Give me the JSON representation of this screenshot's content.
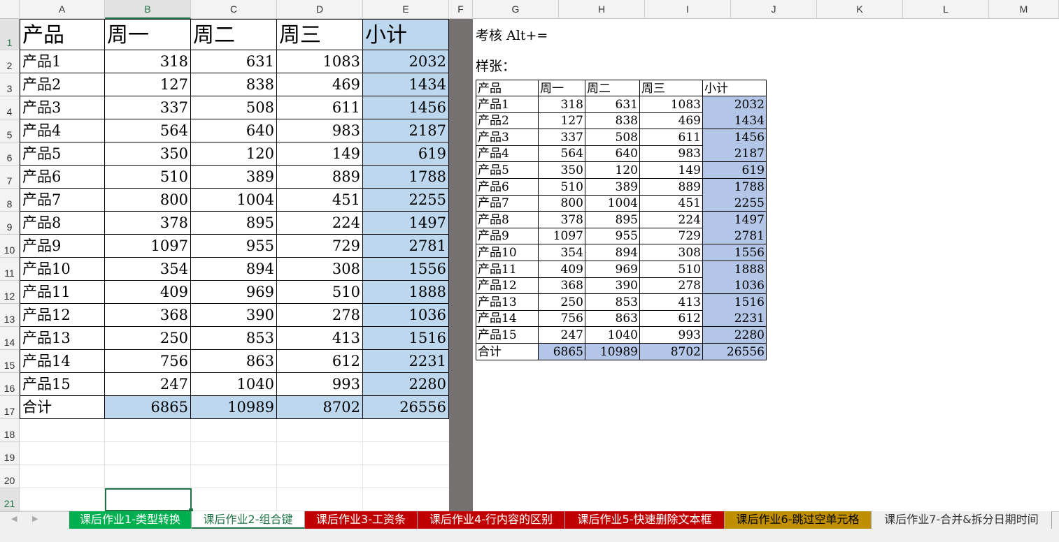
{
  "columns": [
    "A",
    "B",
    "C",
    "D",
    "E",
    "F",
    "G",
    "H",
    "I",
    "J",
    "K",
    "L",
    "M"
  ],
  "rows": [
    "1",
    "2",
    "3",
    "4",
    "5",
    "6",
    "7",
    "8",
    "9",
    "10",
    "11",
    "12",
    "13",
    "14",
    "15",
    "16",
    "17",
    "18",
    "19",
    "20",
    "21"
  ],
  "table": {
    "headers": [
      "产品",
      "周一",
      "周二",
      "周三",
      "小计"
    ],
    "rows": [
      [
        "产品1",
        "318",
        "631",
        "1083",
        "2032"
      ],
      [
        "产品2",
        "127",
        "838",
        "469",
        "1434"
      ],
      [
        "产品3",
        "337",
        "508",
        "611",
        "1456"
      ],
      [
        "产品4",
        "564",
        "640",
        "983",
        "2187"
      ],
      [
        "产品5",
        "350",
        "120",
        "149",
        "619"
      ],
      [
        "产品6",
        "510",
        "389",
        "889",
        "1788"
      ],
      [
        "产品7",
        "800",
        "1004",
        "451",
        "2255"
      ],
      [
        "产品8",
        "378",
        "895",
        "224",
        "1497"
      ],
      [
        "产品9",
        "1097",
        "955",
        "729",
        "2781"
      ],
      [
        "产品10",
        "354",
        "894",
        "308",
        "1556"
      ],
      [
        "产品11",
        "409",
        "969",
        "510",
        "1888"
      ],
      [
        "产品12",
        "368",
        "390",
        "278",
        "1036"
      ],
      [
        "产品13",
        "250",
        "853",
        "413",
        "1516"
      ],
      [
        "产品14",
        "756",
        "863",
        "612",
        "2231"
      ],
      [
        "产品15",
        "247",
        "1040",
        "993",
        "2280"
      ]
    ],
    "total": [
      "合计",
      "6865",
      "10989",
      "8702",
      "26556"
    ]
  },
  "note": {
    "line1": "考核 Alt+=",
    "line2": "样张："
  },
  "sample": {
    "headers": [
      "产品",
      "周一",
      "周二",
      "周三",
      "小计"
    ],
    "rows": [
      [
        "产品1",
        "318",
        "631",
        "1083",
        "2032"
      ],
      [
        "产品2",
        "127",
        "838",
        "469",
        "1434"
      ],
      [
        "产品3",
        "337",
        "508",
        "611",
        "1456"
      ],
      [
        "产品4",
        "564",
        "640",
        "983",
        "2187"
      ],
      [
        "产品5",
        "350",
        "120",
        "149",
        "619"
      ],
      [
        "产品6",
        "510",
        "389",
        "889",
        "1788"
      ],
      [
        "产品7",
        "800",
        "1004",
        "451",
        "2255"
      ],
      [
        "产品8",
        "378",
        "895",
        "224",
        "1497"
      ],
      [
        "产品9",
        "1097",
        "955",
        "729",
        "2781"
      ],
      [
        "产品10",
        "354",
        "894",
        "308",
        "1556"
      ],
      [
        "产品11",
        "409",
        "969",
        "510",
        "1888"
      ],
      [
        "产品12",
        "368",
        "390",
        "278",
        "1036"
      ],
      [
        "产品13",
        "250",
        "853",
        "413",
        "1516"
      ],
      [
        "产品14",
        "756",
        "863",
        "612",
        "2231"
      ],
      [
        "产品15",
        "247",
        "1040",
        "993",
        "2280"
      ]
    ],
    "total": [
      "合计",
      "6865",
      "10989",
      "8702",
      "26556"
    ]
  },
  "tabs": [
    {
      "label": "课后作业1-类型转换",
      "bg": "#00b050",
      "color": "#ffffff"
    },
    {
      "label": "课后作业2-组合键",
      "bg": "#ffffff",
      "color": "#217346",
      "active": true
    },
    {
      "label": "课后作业3-工资条",
      "bg": "#c00000",
      "color": "#ffffff"
    },
    {
      "label": "课后作业4-行内容的区别",
      "bg": "#c00000",
      "color": "#ffffff"
    },
    {
      "label": "课后作业5-快速删除文本框",
      "bg": "#c00000",
      "color": "#ffffff"
    },
    {
      "label": "课后作业6-跳过空单元格",
      "bg": "#bf8f00",
      "color": "#000000"
    },
    {
      "label": "课后作业7-合并&拆分日期时间",
      "bg": "#f0f0f0",
      "color": "#333333"
    }
  ],
  "nav": {
    "prev": "◀",
    "next": "▶"
  },
  "colors": {
    "accent": "#217346",
    "subtotal_fill": "#bdd7ee",
    "sample_fill": "#b4c6e7",
    "frozen_bar": "#767171"
  }
}
